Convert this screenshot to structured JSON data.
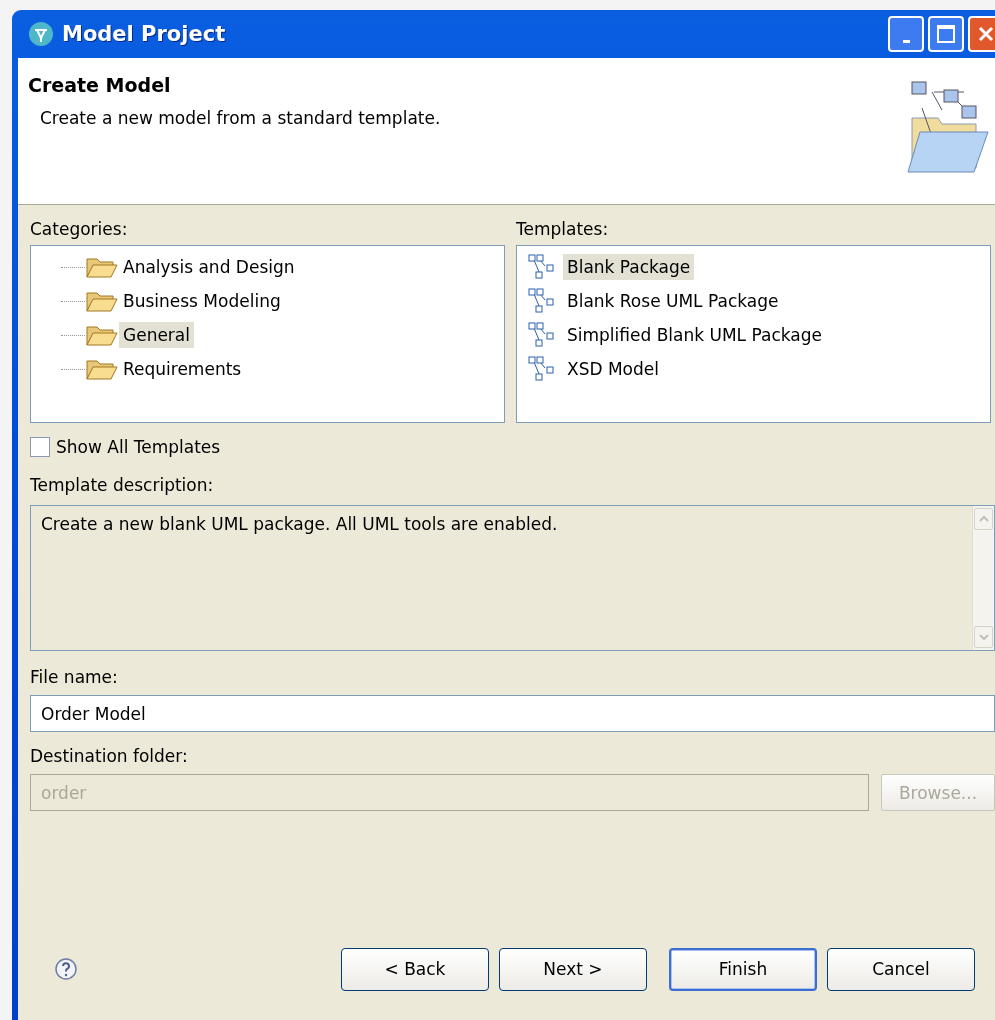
{
  "window": {
    "title": "Model Project"
  },
  "header": {
    "title": "Create Model",
    "description": "Create a new model from a standard template."
  },
  "categories": {
    "label": "Categories:",
    "items": [
      {
        "label": "Analysis and Design",
        "selected": false
      },
      {
        "label": "Business Modeling",
        "selected": false
      },
      {
        "label": "General",
        "selected": true
      },
      {
        "label": "Requirements",
        "selected": false
      }
    ]
  },
  "templates": {
    "label": "Templates:",
    "items": [
      {
        "label": "Blank Package",
        "selected": true
      },
      {
        "label": "Blank Rose UML Package",
        "selected": false
      },
      {
        "label": "Simplified Blank UML Package",
        "selected": false
      },
      {
        "label": "XSD Model",
        "selected": false
      }
    ]
  },
  "show_all_templates": {
    "label": "Show All Templates",
    "checked": false
  },
  "template_description": {
    "label": "Template description:",
    "text": "Create a new blank UML package. All UML tools are enabled."
  },
  "file_name": {
    "label": "File name:",
    "value": "Order Model"
  },
  "destination_folder": {
    "label": "Destination folder:",
    "value": "order",
    "disabled": true,
    "browse": {
      "label": "Browse...",
      "disabled": true
    }
  },
  "buttons": [
    {
      "label": "< Back",
      "default": false
    },
    {
      "label": "Next >",
      "default": false
    },
    {
      "label": "Finish",
      "default": true
    },
    {
      "label": "Cancel",
      "default": false
    }
  ]
}
